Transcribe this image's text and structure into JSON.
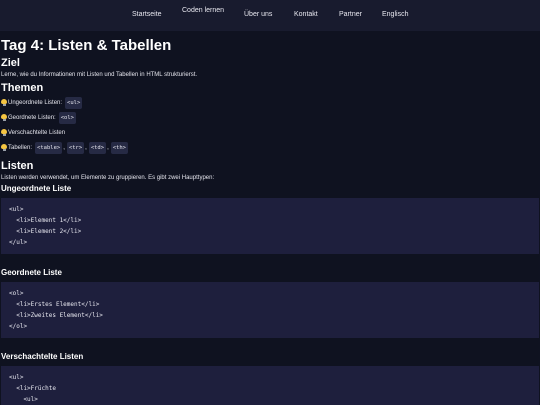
{
  "nav": {
    "items": [
      "Startseite",
      "Coden lernen",
      "Über uns",
      "Kontakt",
      "Partner",
      "Englisch"
    ]
  },
  "page": {
    "title": "Tag 4: Listen & Tabellen",
    "goal_heading": "Ziel",
    "goal_text": "Lerne, wie du Informationen mit Listen und Tabellen in HTML strukturierst.",
    "themes_heading": "Themen",
    "themes": {
      "unordered_label": "Ungeordnete Listen:",
      "unordered_tag": "<ul>",
      "ordered_label": "Geordnete Listen:",
      "ordered_tag": "<ol>",
      "nested_label": "Verschachtelte Listen",
      "tables_label": "Tabellen:",
      "tables_tags": [
        "<table>",
        "<tr>",
        "<td>",
        "<th>"
      ],
      "comma": ","
    },
    "lists_heading": "Listen",
    "lists_intro": "Listen werden verwendet, um Elemente zu gruppieren. Es gibt zwei Haupttypen:",
    "unordered_heading": "Ungeordnete Liste",
    "unordered_code": "<ul>\n  <li>Element 1</li>\n  <li>Element 2</li>\n</ul>",
    "ordered_heading": "Geordnete Liste",
    "ordered_code": "<ol>\n  <li>Erstes Element</li>\n  <li>Zweites Element</li>\n</ol>",
    "nested_heading": "Verschachtelte Listen",
    "nested_code": "<ul>\n  <li>Früchte\n    <ul>\n      <li>Apfel</li>"
  },
  "colors": {
    "background": "#0f1220",
    "nav_background": "#181b2e",
    "code_background": "#1e1f3d",
    "bulb": "#f5c542"
  },
  "icons": [
    "lightbulb-icon"
  ]
}
